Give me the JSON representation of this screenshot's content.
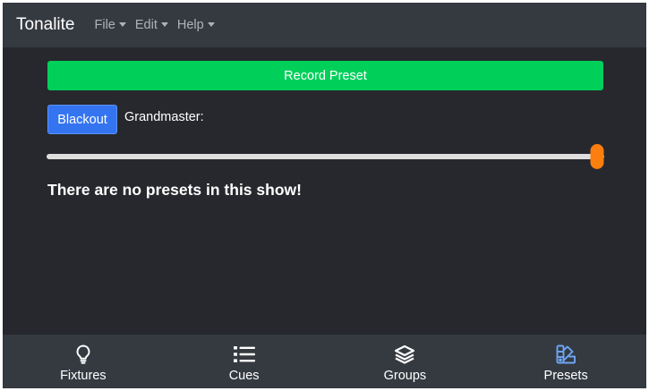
{
  "app": {
    "brand": "Tonalite",
    "menus": [
      {
        "label": "File"
      },
      {
        "label": "Edit"
      },
      {
        "label": "Help"
      }
    ]
  },
  "presets_page": {
    "record_label": "Record Preset",
    "blackout_label": "Blackout",
    "grandmaster_label": "Grandmaster:",
    "grandmaster_value": 1.0,
    "empty_message": "There are no presets in this show!"
  },
  "bottom_nav": {
    "items": [
      {
        "label": "Fixtures",
        "icon": "lightbulb-icon"
      },
      {
        "label": "Cues",
        "icon": "list-icon"
      },
      {
        "label": "Groups",
        "icon": "layers-icon"
      },
      {
        "label": "Presets",
        "icon": "swatchbook-icon",
        "active": true
      }
    ]
  },
  "colors": {
    "record": "#00d05a",
    "blackout": "#3474f0",
    "thumb": "#fb7e0f",
    "active_nav": "#6ea5f4"
  }
}
